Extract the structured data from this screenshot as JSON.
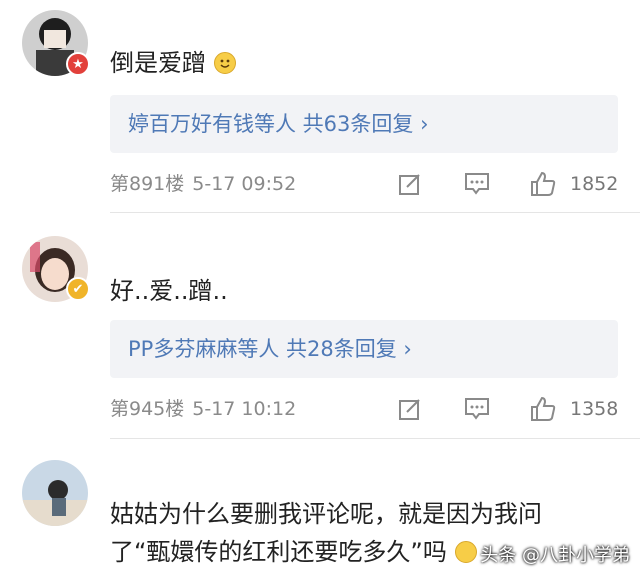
{
  "comments": [
    {
      "text": "倒是爱蹭",
      "replies_text": "婷百万好有钱等人 共63条回复 ›",
      "floor": "第891楼",
      "time": "5-17 09:52",
      "likes": "1852",
      "badge_color": "#e2403b",
      "avatar_colors": [
        "#d9d9d9",
        "#2a2a2a"
      ]
    },
    {
      "text": "好..爱..蹭..",
      "replies_text": "PP多芬麻麻等人 共28条回复 ›",
      "floor": "第945楼",
      "time": "5-17 10:12",
      "likes": "1358",
      "badge_color": "#f0b429",
      "avatar_colors": [
        "#e9d6cf",
        "#6d4b3e"
      ]
    },
    {
      "text_line1": "姑姑为什么要删我评论呢，就是因为我问",
      "text_line2": "了“甄嬛传的红利还要吃多久”吗",
      "avatar_colors": [
        "#c9d8e6",
        "#5a6b7a"
      ]
    }
  ],
  "watermark": "头条 @八卦小学弟",
  "icons": {
    "edit": "edit-icon",
    "comment": "comment-icon",
    "like": "thumbs-up-icon"
  },
  "colors": {
    "link": "#4f79b6",
    "meta": "#8a8a8a",
    "reply_bg": "#f2f3f6"
  }
}
